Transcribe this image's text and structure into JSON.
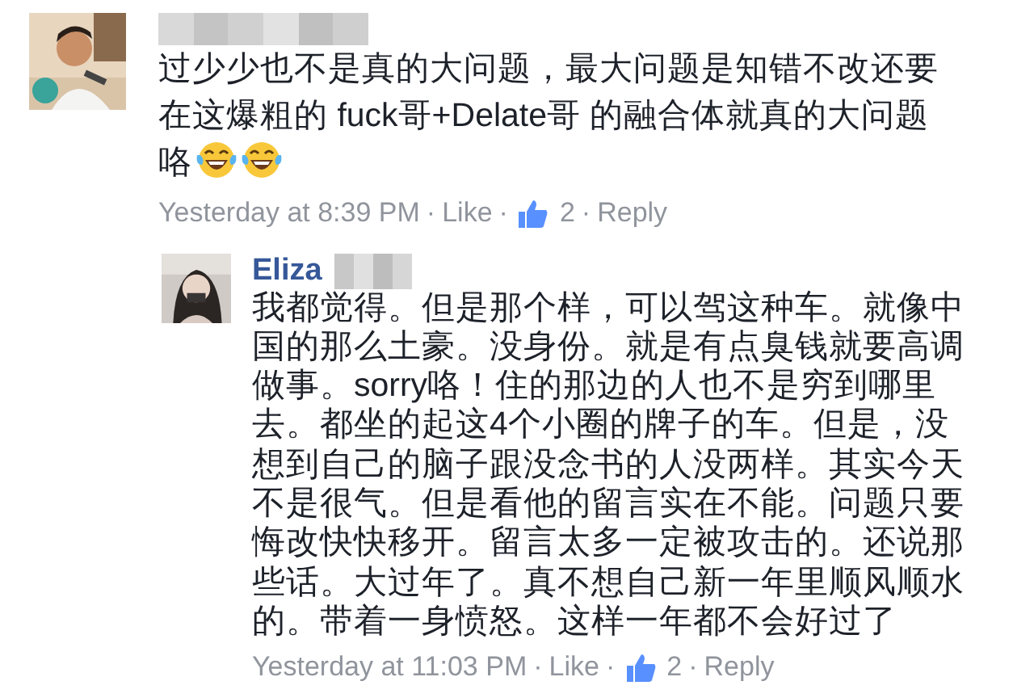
{
  "comments": [
    {
      "name_hidden": true,
      "avatar": {
        "kind": "picture"
      },
      "lines": [
        "过少少也不是真的大问题，最大问题是知错不改还要",
        "在这爆粗的 fuck哥+Delate哥 的融合体就真的大问题",
        "咯"
      ],
      "emojis": [
        {
          "kind": "tears-of-joy"
        },
        {
          "kind": "tears-of-joy"
        }
      ],
      "time": "Yesterday at 8:39 PM",
      "separator": "·",
      "like": "Like",
      "likes": "2",
      "reply": "Reply",
      "replies": [
        {
          "name": "Eliza",
          "surname_hidden": true,
          "avatar": {
            "kind": "picture"
          },
          "lines": [
            "我都觉得。但是那个样，可以驾这种车。就像中",
            "国的那么土豪。没身份。就是有点臭钱就要高调",
            "做事。sorry咯！住的那边的人也不是穷到哪里",
            "去。都坐的起这4个小圈的牌子的车。但是，没",
            "想到自己的脑子跟没念书的人没两样。其实今天",
            "不是很气。但是看他的留言实在不能。问题只要",
            "悔改快快移开。留言太多一定被攻击的。还说那",
            "些话。大过年了。真不想自己新一年里顺风顺水",
            "的。带着一身愤怒。这样一年都不会好过了"
          ],
          "time": "Yesterday at 11:03 PM",
          "separator": "·",
          "like": "Like",
          "likes": "2",
          "reply": "Reply"
        }
      ]
    }
  ]
}
